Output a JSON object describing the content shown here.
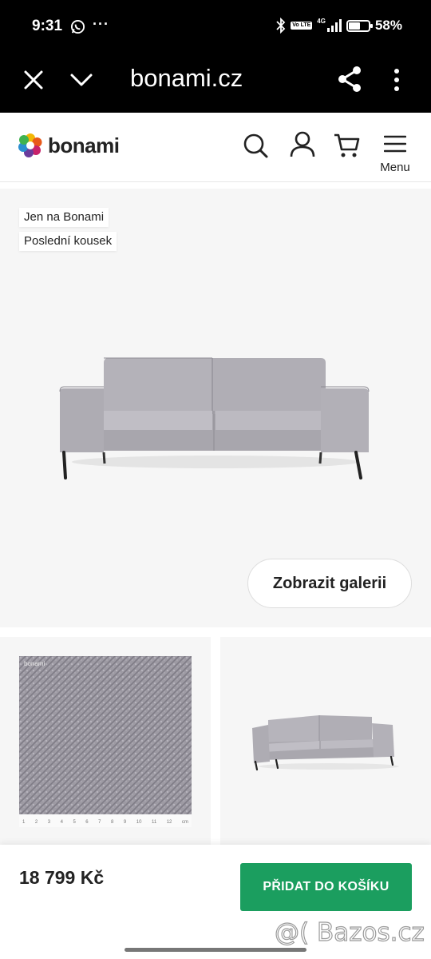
{
  "status_bar": {
    "time": "9:31",
    "more": "···",
    "volte": "Vo LTE",
    "network": "4G",
    "battery_level": 0.58,
    "battery_pct": "58%"
  },
  "browser": {
    "url": "bonami.cz"
  },
  "header": {
    "logo_text": "bonami",
    "menu_label": "Menu"
  },
  "hero": {
    "badges": [
      "Jen na Bonami",
      "Poslední kousek"
    ],
    "gallery_button": "Zobrazit galerii"
  },
  "thumbnails": {
    "fabric_logo": "bonami",
    "ruler_labels": [
      "1",
      "2",
      "3",
      "4",
      "5",
      "6",
      "7",
      "8",
      "9",
      "10",
      "11",
      "12",
      "cm"
    ]
  },
  "bottom_bar": {
    "price": "18 799 Kč",
    "add_to_cart": "PŘIDAT DO KOŠÍKU"
  },
  "watermark": "@( Bazos.cz",
  "colors": {
    "accent_green": "#1b9e5f",
    "sofa_grey": "#bdbbc2",
    "hero_bg": "#f6f6f6"
  }
}
